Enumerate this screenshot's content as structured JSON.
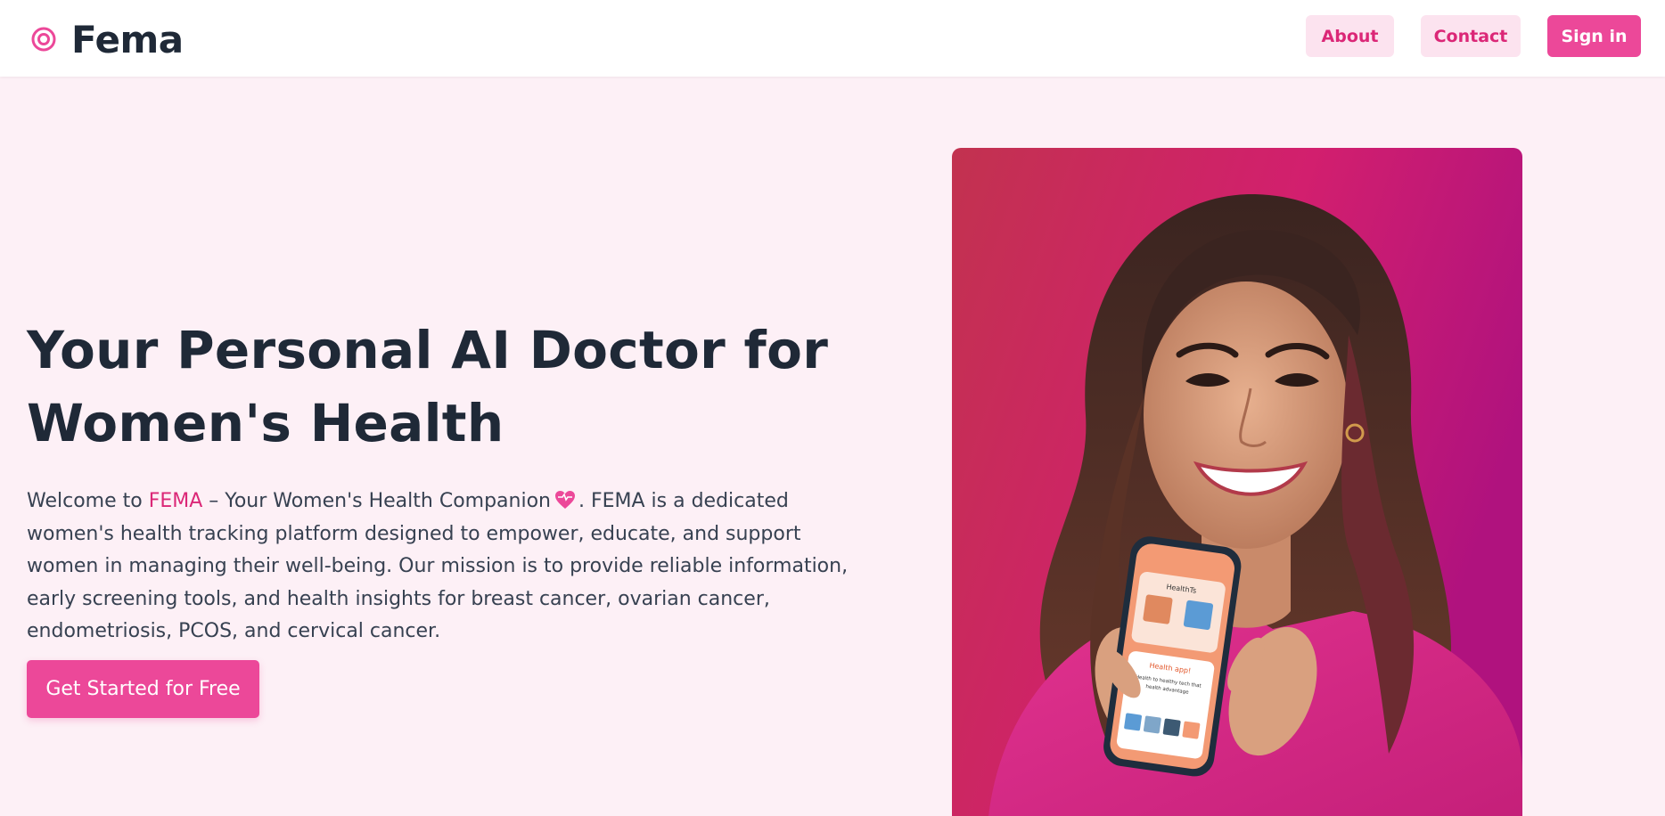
{
  "brand": {
    "name": "Fema",
    "icon": "target-icon"
  },
  "nav": {
    "about": "About",
    "contact": "Contact",
    "signin": "Sign in"
  },
  "hero": {
    "title": "Your Personal AI Doctor for Women's Health",
    "desc_welcome": "Welcome to ",
    "desc_highlight": "FEMA",
    "desc_tagline": " – Your Women's Health Companion",
    "desc_rest": ". FEMA is a dedicated women's health tracking platform designed to empower, educate, and support women in managing their well-being. Our mission is to provide reliable information, early screening tools, and health insights for breast cancer, ovarian cancer, endometriosis, PCOS, and cervical cancer.",
    "emoji": "heart-icon",
    "cta": "Get Started for Free",
    "image": "woman-holding-phone-photo"
  },
  "phone_screen": {
    "header": "HealthTs",
    "card_title": "Health app!",
    "card_text_1": "Health to healthy tech that",
    "card_text_2": "health advantage"
  },
  "colors": {
    "accent": "#ec4899",
    "accent_text": "#db2777",
    "accent_light": "#fce3ef",
    "background": "#fdf0f6",
    "heading": "#1f2937"
  }
}
